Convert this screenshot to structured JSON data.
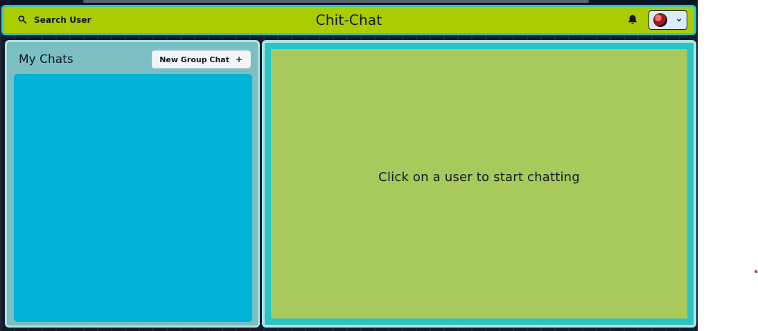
{
  "header": {
    "title": "Chit-Chat",
    "search_label": "Search User",
    "icons": {
      "search": "search-icon",
      "bell": "bell-icon",
      "avatar_menu_chevron": "chevron-down-icon"
    },
    "colors": {
      "bar": "#aacc00",
      "border": "#2bc4c2",
      "avatar_button_bg": "#dbeafe"
    }
  },
  "left": {
    "title": "My Chats",
    "new_group_label": "New Group Chat",
    "icons": {
      "plus": "plus-icon"
    },
    "colors": {
      "panel_bg": "#7bbfc2",
      "panel_border": "#a9e5e7",
      "list_bg": "#00b2d6",
      "button_bg": "#f3f4f6"
    }
  },
  "right": {
    "empty_state": "Click on a user to start chatting",
    "colors": {
      "outer_bg": "#a9e5e7",
      "inner_border": "#2bc4c2",
      "inner_bg": "#a8c95b"
    }
  }
}
